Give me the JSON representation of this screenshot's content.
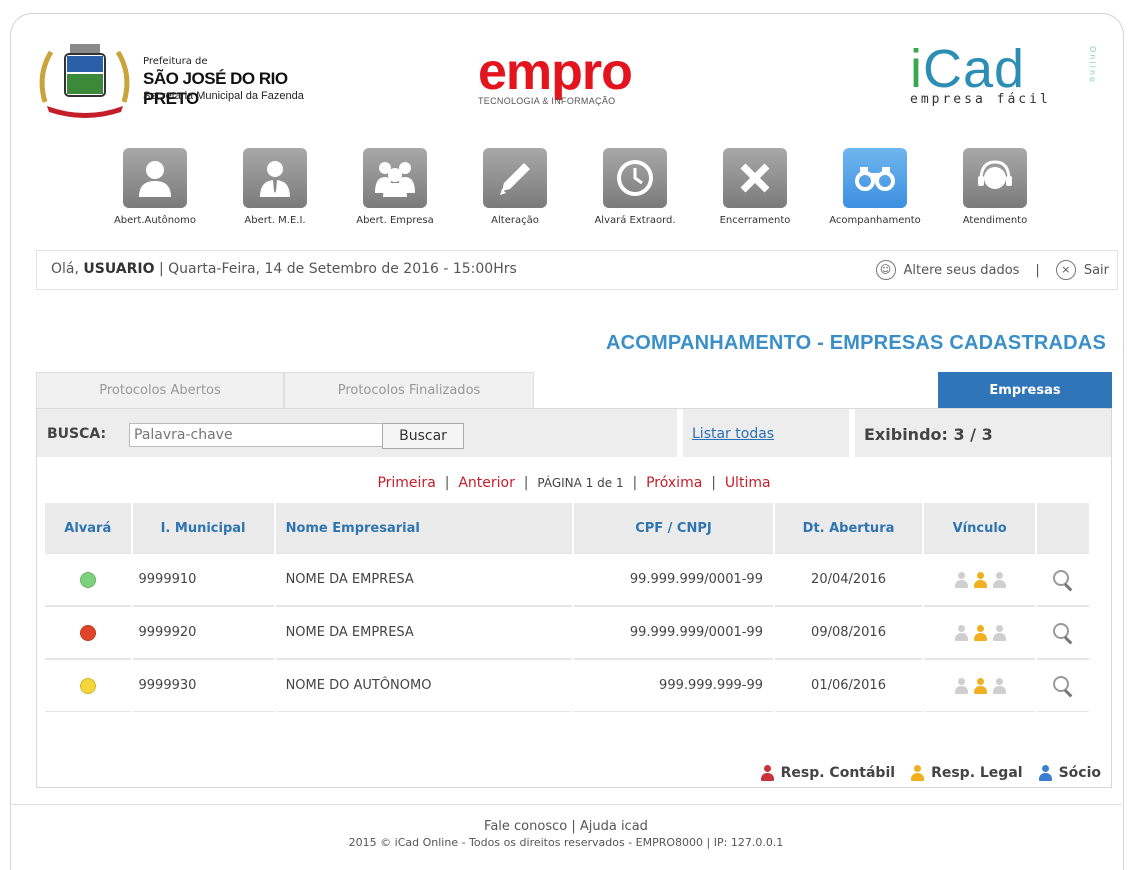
{
  "header": {
    "pref_line1": "Prefeitura de",
    "pref_line2": "SÃO JOSÉ DO RIO PRETO",
    "pref_line3": "Secretaria Municipal da Fazenda",
    "empro_word": "empro",
    "empro_sub": "TECNOLOGIA & INFORMAÇÃO",
    "icad_i": "i",
    "icad_rest": "Cad",
    "icad_sub": "empresa fácil",
    "icad_online": "Online"
  },
  "nav": [
    {
      "label": "Abert.Autônomo",
      "icon": "person-icon"
    },
    {
      "label": "Abert. M.E.I.",
      "icon": "businessman-icon"
    },
    {
      "label": "Abert. Empresa",
      "icon": "group-icon"
    },
    {
      "label": "Alteração",
      "icon": "pencil-icon"
    },
    {
      "label": "Alvará Extraord.",
      "icon": "clock-icon"
    },
    {
      "label": "Encerramento",
      "icon": "close-icon"
    },
    {
      "label": "Acompanhamento",
      "icon": "binoculars-icon",
      "active": true
    },
    {
      "label": "Atendimento",
      "icon": "headset-icon"
    }
  ],
  "status": {
    "greeting": "Olá,",
    "user": "USUARIO",
    "date": "| Quarta-Feira, 14 de Setembro de 2016 - 15:00Hrs",
    "edit_label": "Altere seus dados",
    "divider": "|",
    "logout_label": "Sair"
  },
  "page_title": "ACOMPANHAMENTO - EMPRESAS CADASTRADAS",
  "tabs": [
    {
      "label": "Protocolos Abertos"
    },
    {
      "label": "Protocolos Finalizados"
    },
    {
      "label": "Empresas"
    }
  ],
  "search": {
    "label": "BUSCA:",
    "placeholder": "Palavra-chave",
    "button": "Buscar",
    "list_all": "Listar todas",
    "showing": "Exibindo: 3 / 3"
  },
  "pager": {
    "first": "Primeira",
    "prev": "Anterior",
    "info": "PÁGINA 1 de 1",
    "next": "Próxima",
    "last": "Ultima",
    "sep": "|"
  },
  "table": {
    "headers": [
      "Alvará",
      "I. Municipal",
      "Nome Empresarial",
      "CPF / CNPJ",
      "Dt. Abertura",
      "Vínculo",
      ""
    ],
    "rows": [
      {
        "alvara_color": "#7cd27a",
        "im": "9999910",
        "nome": "NOME DA EMPRESA",
        "doc": "99.999.999/0001-99",
        "data": "20/04/2016"
      },
      {
        "alvara_color": "#e0452b",
        "im": "9999920",
        "nome": "NOME DA EMPRESA",
        "doc": "99.999.999/0001-99",
        "data": "09/08/2016"
      },
      {
        "alvara_color": "#f5d63a",
        "im": "9999930",
        "nome": "NOME DO AUTÔNOMO",
        "doc": "999.999.999-99",
        "data": "01/06/2016"
      }
    ]
  },
  "legend": {
    "contabil": "Resp. Contábil",
    "legal": "Resp. Legal",
    "socio": "Sócio"
  },
  "colors": {
    "contabil": "#c8323a",
    "legal": "#f0b020",
    "socio": "#3b7fd0",
    "inactive": "#cfcfcf"
  },
  "footer": {
    "line1": "Fale conosco | Ajuda icad",
    "line2": "2015 © iCad Online - Todos os direitos reservados - EMPRO8000 | IP: 127.0.0.1"
  }
}
